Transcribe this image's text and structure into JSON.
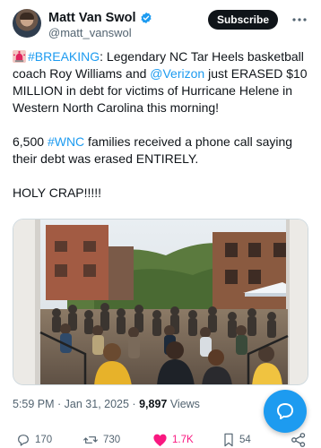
{
  "author": {
    "display_name": "Matt Van Swol",
    "handle": "@matt_vanswol"
  },
  "header": {
    "subscribe_label": "Subscribe"
  },
  "tweet": {
    "p1": {
      "hashtag": "#BREAKING",
      "text_a": ": Legendary NC Tar Heels basketball coach Roy Williams and ",
      "mention": "@Verizon",
      "text_b": " just ERASED $10 MILLION in debt for victims of Hurricane Helene in Western North Carolina this morning!"
    },
    "p2": {
      "text_a": "6,500 ",
      "hashtag": "#WNC",
      "text_b": " families received a phone call saying their debt was erased ENTIRELY."
    },
    "p3": "HOLY CRAP!!!!!"
  },
  "meta": {
    "timestamp": "5:59 PM · Jan 31, 2025 · ",
    "views_count": "9,897",
    "views_label": " Views"
  },
  "actions": {
    "replies": "170",
    "reposts": "730",
    "likes": "1.7K",
    "bookmarks": "54"
  },
  "icons": {
    "siren": "rotating-light-icon",
    "verified": "verified-badge-icon",
    "more": "more-horizontal-icon",
    "fab": "compose-message-icon",
    "reply": "reply-icon",
    "repost": "repost-icon",
    "like": "heart-icon",
    "bookmark": "bookmark-icon",
    "share": "share-icon"
  },
  "colors": {
    "accent": "#1d9bf0",
    "like": "#f91880",
    "text": "#0f1419",
    "secondary": "#536471"
  }
}
